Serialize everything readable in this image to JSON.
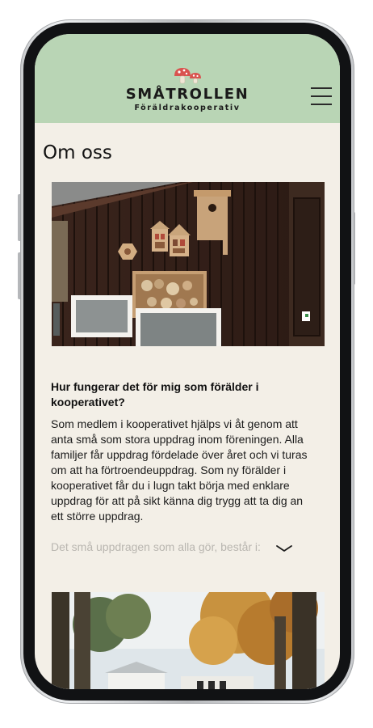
{
  "header": {
    "logo_title": "SMÅTROLLEN",
    "logo_subtitle": "Föräldrakooperativ",
    "background": "#b9d5b5",
    "menu_icon": "hamburger-menu-icon"
  },
  "page": {
    "title": "Om oss",
    "background": "#f3efe7"
  },
  "article": {
    "heading": "Hur fungerar det för mig som förälder i kooperativet?",
    "body": "Som medlem i kooperativet hjälps vi åt genom att anta små som stora uppdrag inom föreningen. Alla familjer får uppdrag fördelade över året och vi turas om att ha förtroendeuppdrag. Som ny förälder i kooperativet får du i lugn takt börja med enklare uppdrag för att på sikt känna dig trygg att ta dig an ett större uppdrag.",
    "continuation": "Det små uppdragen som alla gör, består i:",
    "expand_icon": "chevron-down-icon"
  },
  "accent_colors": {
    "mushroom_cap": "#d9534f",
    "text": "#1a1a1a"
  }
}
